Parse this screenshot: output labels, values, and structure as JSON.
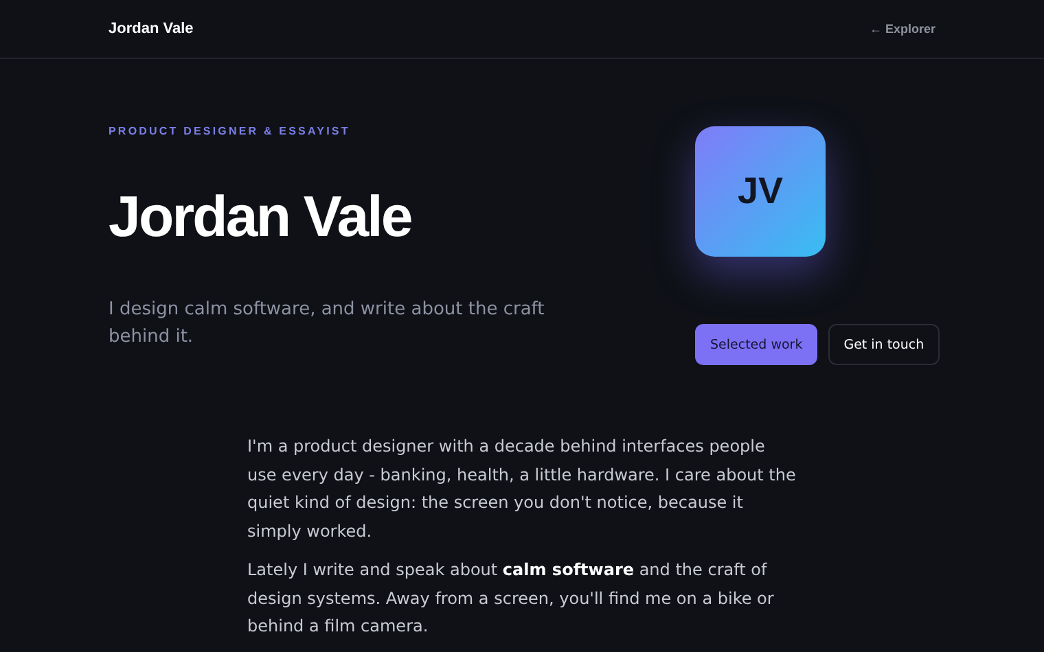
{
  "header": {
    "brand": "Jordan Vale",
    "back_link": "← Explorer"
  },
  "hero": {
    "eyebrow": "PRODUCT DESIGNER & ESSAYIST",
    "name": "Jordan Vale",
    "tagline": "I design calm software, and write about the craft behind it.",
    "avatar_initials": "JV",
    "buttons": [
      {
        "label": "Selected work",
        "kind": "primary"
      },
      {
        "label": "Get in touch",
        "kind": "secondary"
      }
    ]
  },
  "about": [
    "I'm a product designer with a decade behind interfaces people use every day - banking, health, a little hardware. I care about the quiet kind of design: the screen you don't notice, because it simply worked.",
    "Lately I write and speak about **calm software** and the craft of design systems. Away from a screen, you'll find me on a bike or behind a film camera."
  ]
}
